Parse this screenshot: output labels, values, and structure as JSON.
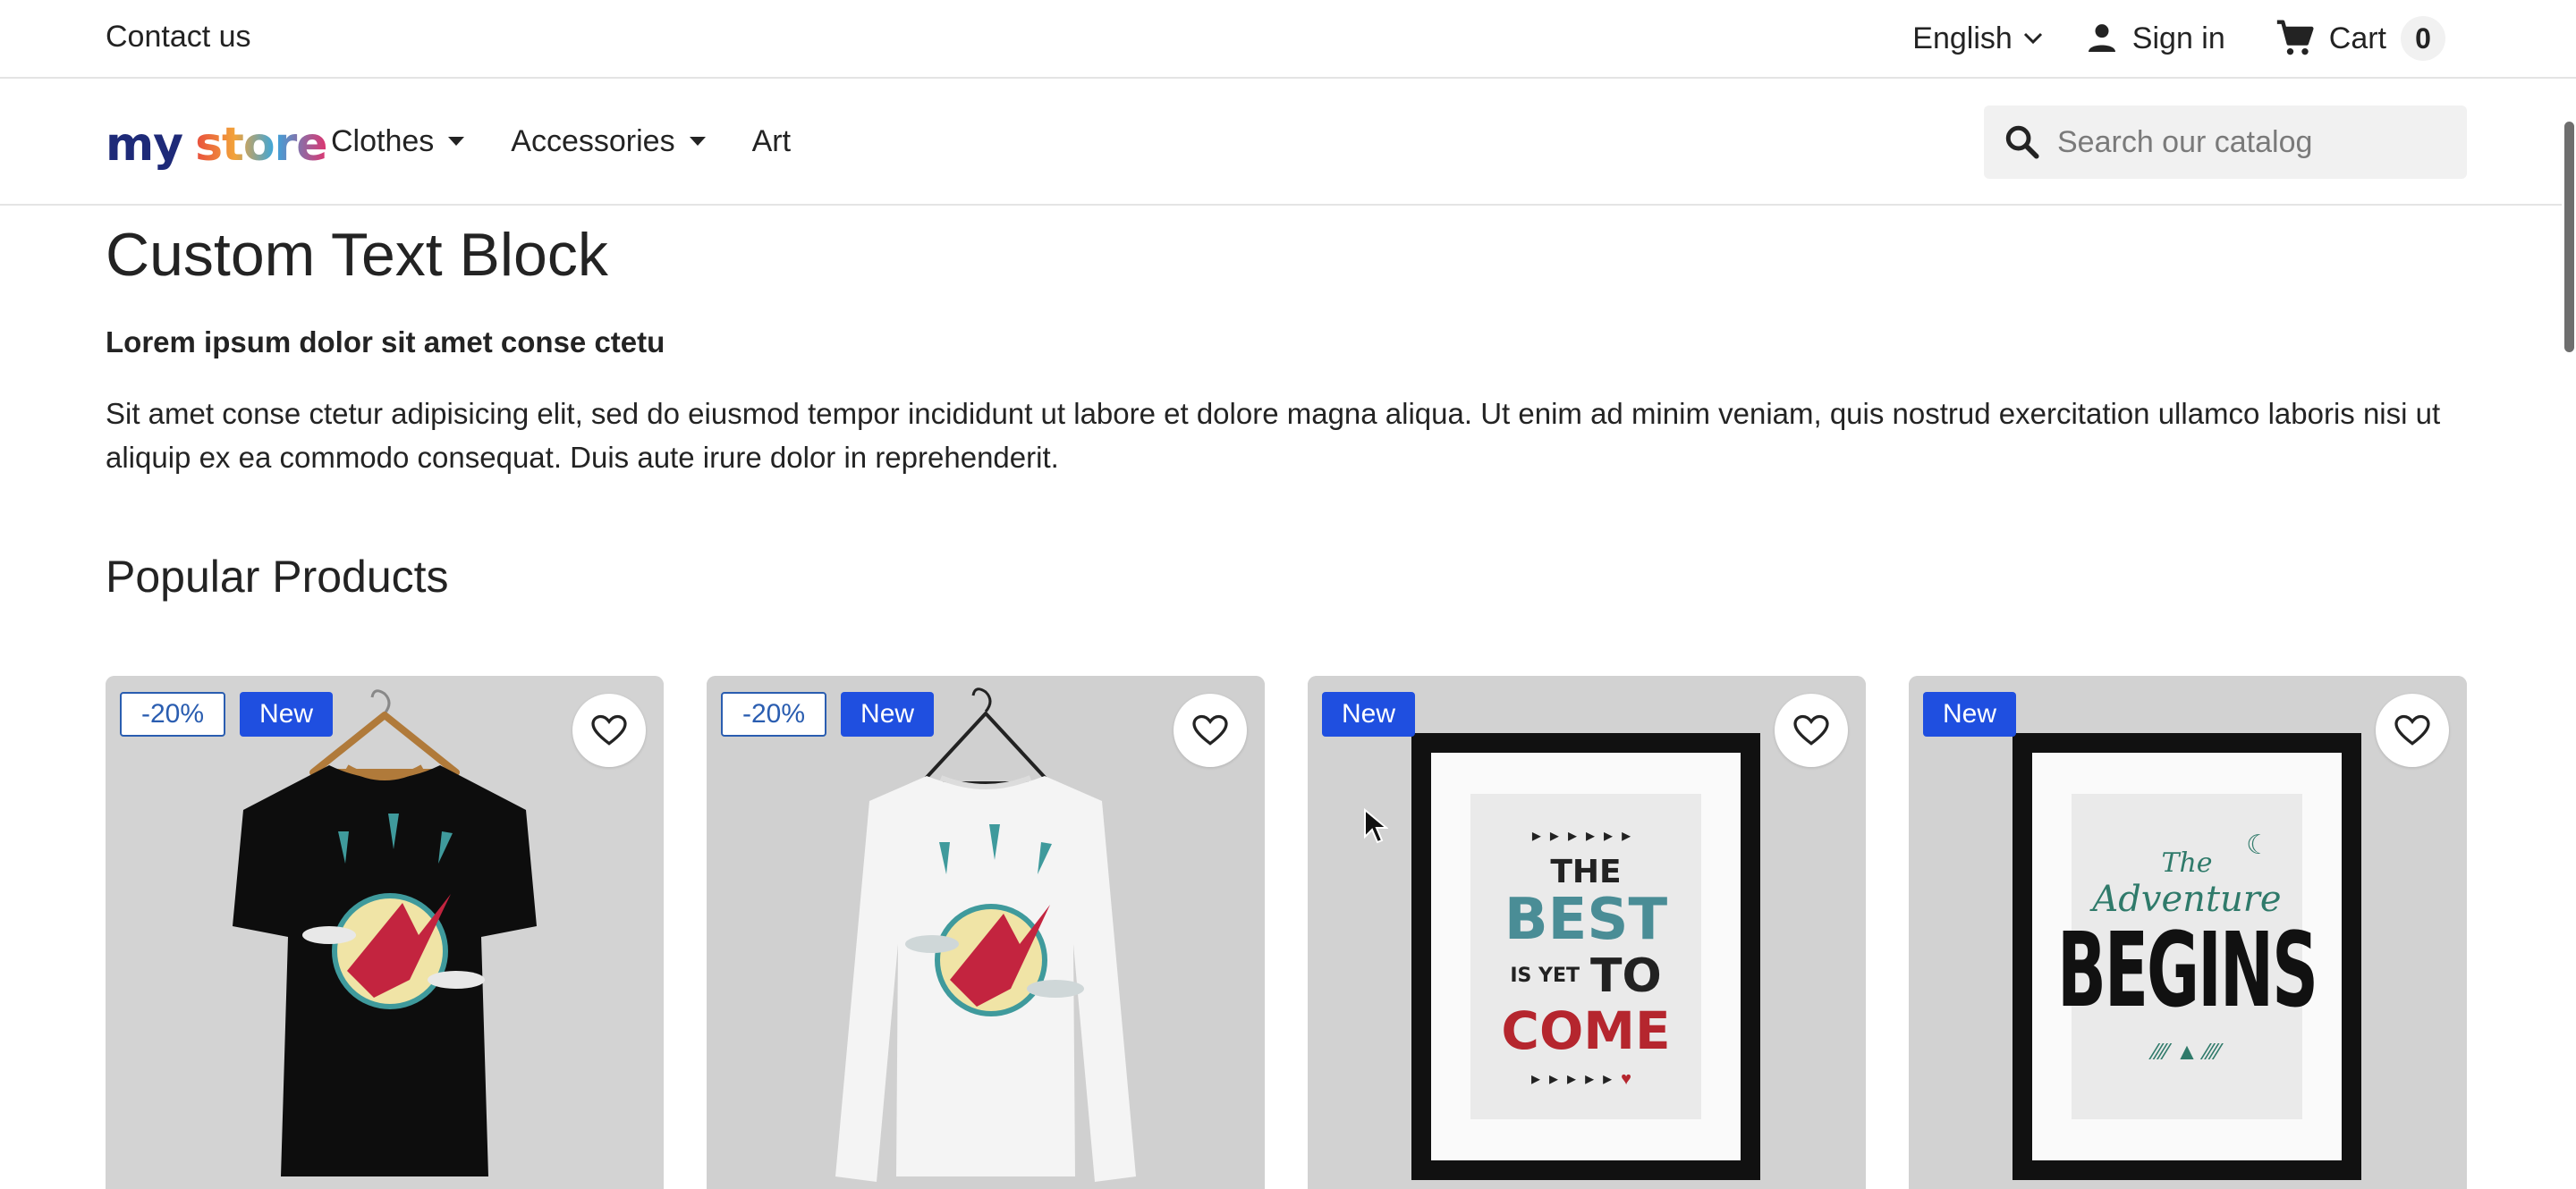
{
  "topbar": {
    "contact": "Contact us",
    "language": "English",
    "signin": "Sign in",
    "cart_label": "Cart",
    "cart_count": "0"
  },
  "header": {
    "logo": {
      "text_my": "my",
      "text_store": "store"
    },
    "nav": [
      {
        "label": "Clothes",
        "has_dropdown": true
      },
      {
        "label": "Accessories",
        "has_dropdown": true
      },
      {
        "label": "Art",
        "has_dropdown": false
      }
    ],
    "search_placeholder": "Search our catalog"
  },
  "content": {
    "cms_title": "Custom Text Block",
    "cms_subtitle": "Lorem ipsum dolor sit amet conse ctetu",
    "cms_body": "Sit amet conse ctetur adipisicing elit, sed do eiusmod tempor incididunt ut labore et dolore magna aliqua. Ut enim ad minim veniam, quis nostrud exercitation ullamco laboris nisi ut aliquip ex ea commodo consequat. Duis aute irure dolor in reprehenderit.",
    "section_title": "Popular Products"
  },
  "products": [
    {
      "discount": "-20%",
      "flag": "New",
      "image": "black-tshirt-hummingbird"
    },
    {
      "discount": "-20%",
      "flag": "New",
      "image": "white-sweater-hummingbird"
    },
    {
      "discount": "",
      "flag": "New",
      "image": "poster-the-best-is-yet-to-come"
    },
    {
      "discount": "",
      "flag": "New",
      "image": "poster-the-adventure-begins"
    }
  ],
  "poster1": {
    "line1": "THE",
    "line2": "BEST",
    "line3": "IS YET",
    "line4": "TO",
    "line5": "COME"
  },
  "poster2": {
    "line1": "The",
    "line2": "Adventure",
    "line3": "BEGINS"
  },
  "colors": {
    "accent": "#1f4fe0",
    "discount_border": "#2a5db0",
    "card_bg": "#d5d5d5"
  }
}
